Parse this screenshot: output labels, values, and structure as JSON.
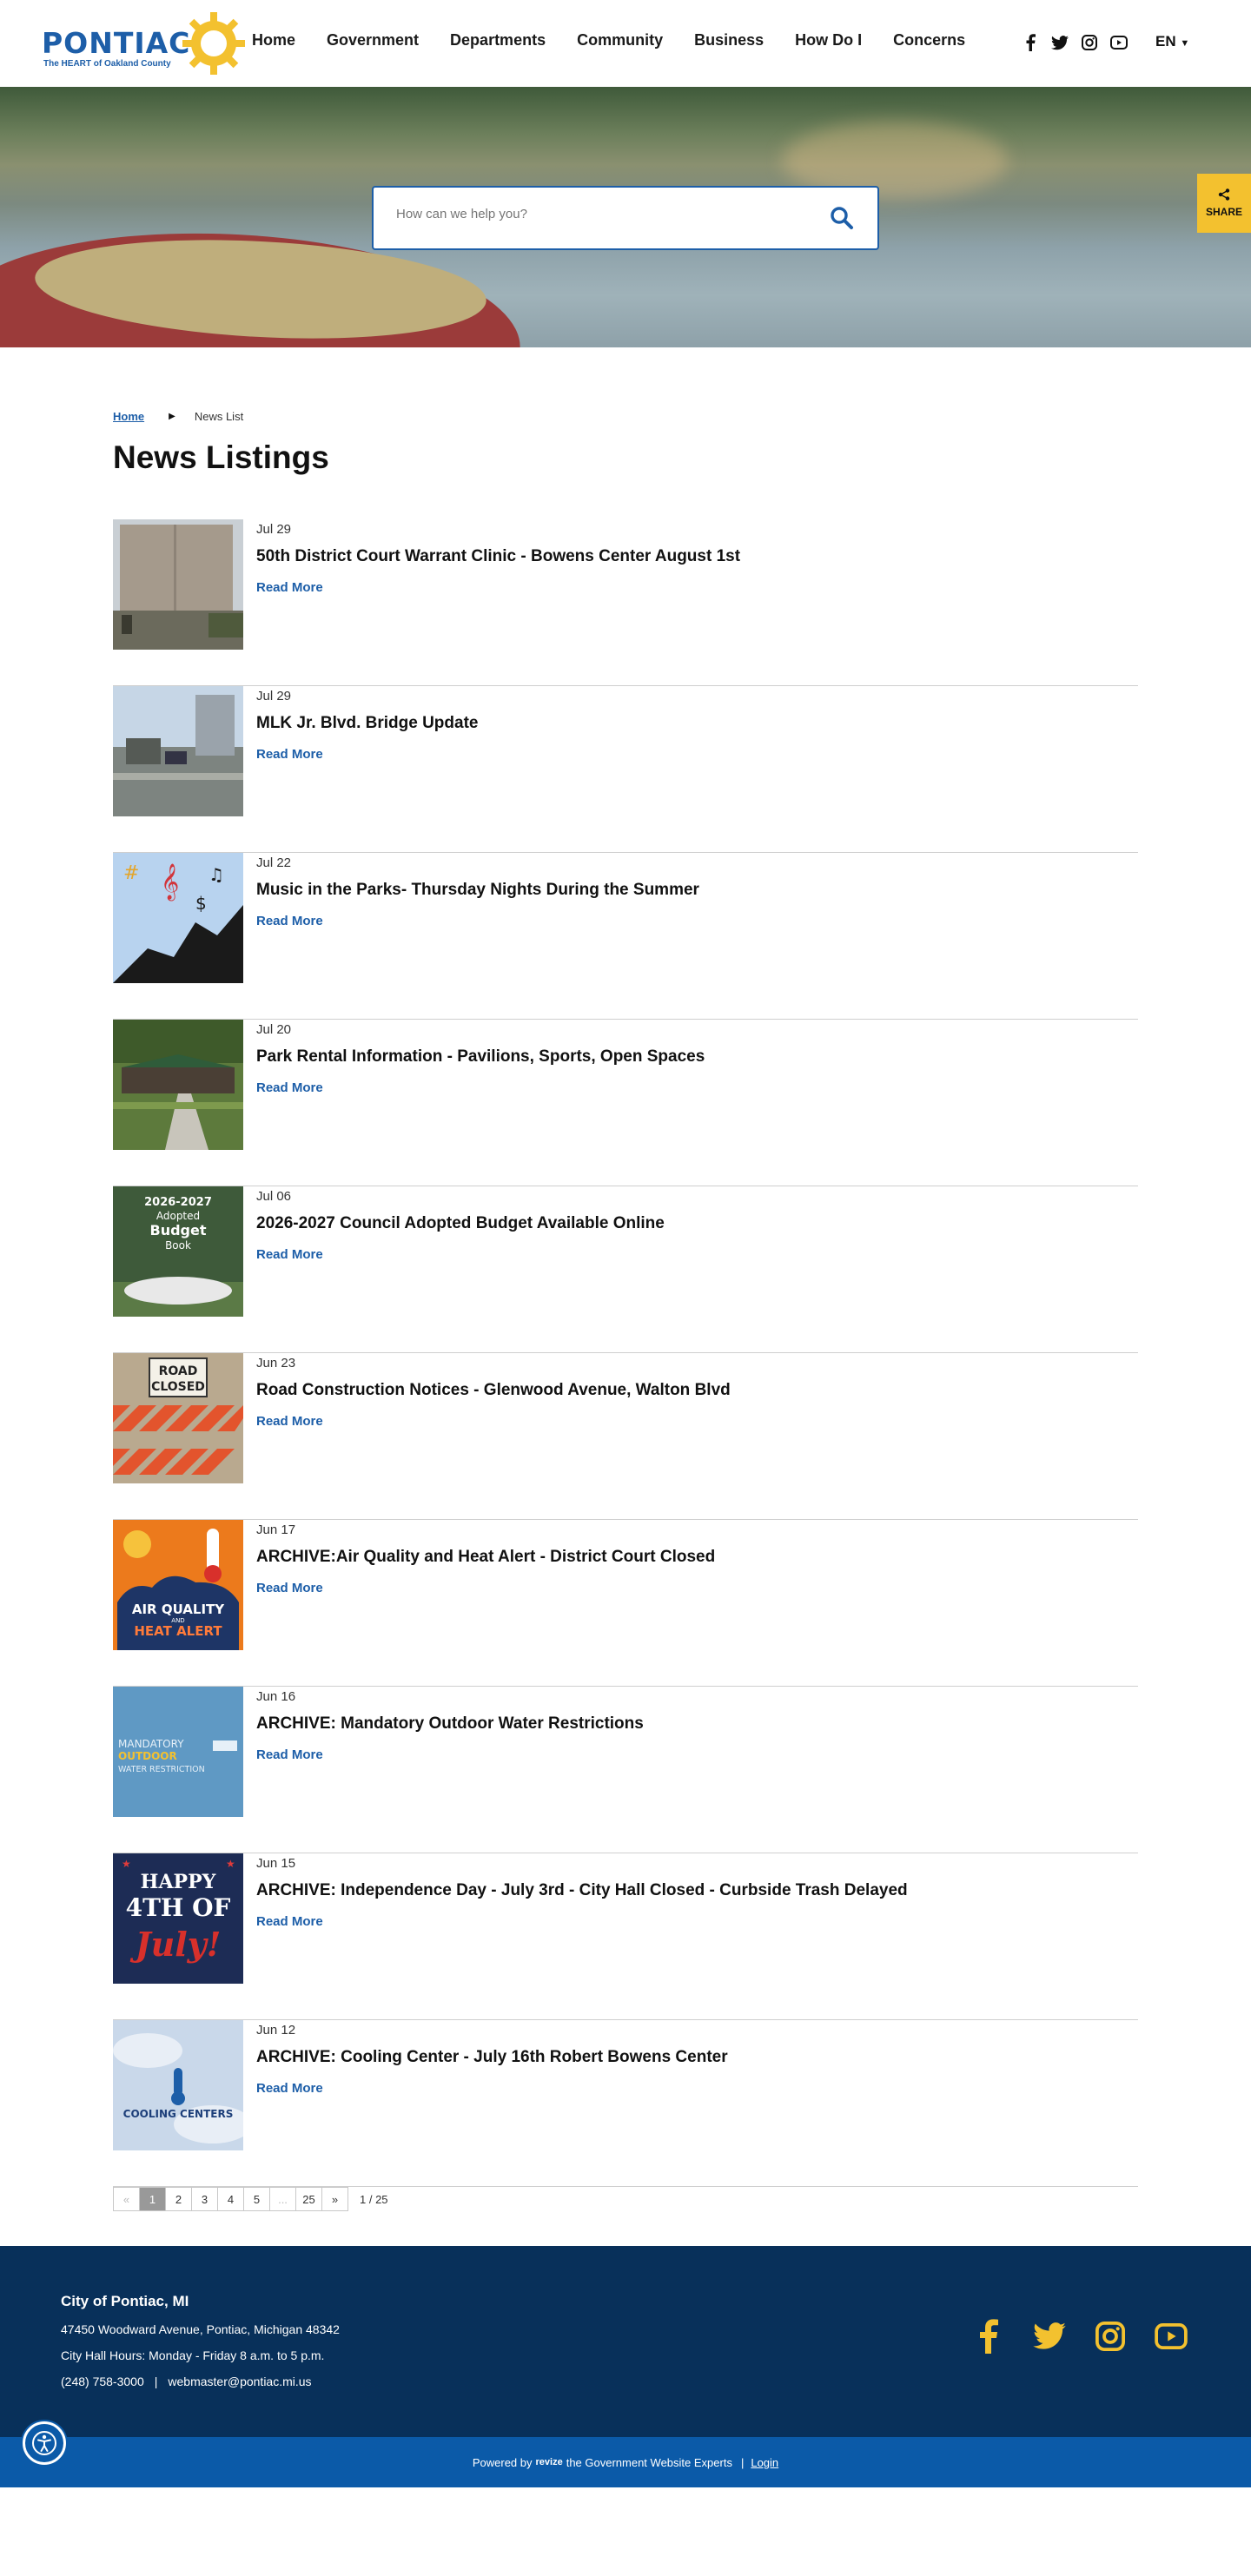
{
  "brand": {
    "logo_word": "PONTIAC",
    "logo_tagline": "The HEART of Oakland County",
    "primary_color": "#1d5ea8",
    "accent_color": "#f3c12f",
    "footer_color": "#08305a"
  },
  "nav": {
    "items": [
      "Home",
      "Government",
      "Departments",
      "Community",
      "Business",
      "How Do I",
      "Concerns"
    ]
  },
  "header_social": [
    "facebook-icon",
    "twitter-icon",
    "instagram-icon",
    "youtube-icon"
  ],
  "language": {
    "label": "EN"
  },
  "search": {
    "placeholder": "How can we help you?"
  },
  "share": {
    "label": "SHARE"
  },
  "breadcrumb": {
    "home": "Home",
    "current": "News List"
  },
  "page_title": "News Listings",
  "news": [
    {
      "date": "Jul 29",
      "title": "50th District Court Warrant Clinic - Bowens Center August 1st",
      "link": "Read More",
      "thumb": "building"
    },
    {
      "date": "Jul 29",
      "title": "MLK Jr. Blvd. Bridge Update",
      "link": "Read More",
      "thumb": "bridge"
    },
    {
      "date": "Jul 22",
      "title": "Music in the Parks- Thursday Nights During the Summer",
      "link": "Read More",
      "thumb": "music"
    },
    {
      "date": "Jul 20",
      "title": "Park Rental Information - Pavilions, Sports, Open Spaces",
      "link": "Read More",
      "thumb": "park"
    },
    {
      "date": "Jul 06",
      "title": "2026-2027 Council Adopted Budget Available Online",
      "link": "Read More",
      "thumb": "budget",
      "thumb_text": [
        "2026-2027",
        "Adopted",
        "Budget",
        "Book"
      ]
    },
    {
      "date": "Jun 23",
      "title": "Road Construction Notices - Glenwood Avenue, Walton Blvd",
      "link": "Read More",
      "thumb": "road",
      "thumb_text": [
        "ROAD",
        "CLOSED"
      ]
    },
    {
      "date": "Jun 17",
      "title": "ARCHIVE:Air Quality and Heat Alert - District Court Closed",
      "link": "Read More",
      "thumb": "heat",
      "thumb_text": [
        "AIR QUALITY",
        "AND",
        "HEAT ALERT"
      ]
    },
    {
      "date": "Jun 16",
      "title": "ARCHIVE: Mandatory Outdoor Water Restrictions",
      "link": "Read More",
      "thumb": "water",
      "thumb_text": [
        "MANDATORY",
        "OUTDOOR",
        "WATER RESTRICTION"
      ]
    },
    {
      "date": "Jun 15",
      "title": "ARCHIVE: Independence Day - July 3rd - City Hall Closed - Curbside Trash Delayed",
      "link": "Read More",
      "thumb": "july",
      "thumb_text": [
        "HAPPY",
        "4TH OF",
        "July!"
      ]
    },
    {
      "date": "Jun 12",
      "title": "ARCHIVE: Cooling Center - July  16th Robert Bowens Center",
      "link": "Read More",
      "thumb": "cooling",
      "thumb_text": [
        "COOLING CENTERS"
      ]
    }
  ],
  "pagination": {
    "prev": "«",
    "pages": [
      "1",
      "2",
      "3",
      "4",
      "5",
      "...",
      "25"
    ],
    "next": "»",
    "current": 1,
    "count_text": "1 / 25"
  },
  "footer": {
    "name": "City of Pontiac, MI",
    "address": "47450 Woodward Avenue, Pontiac, Michigan 48342",
    "hours": "City Hall Hours: Monday - Friday 8 a.m. to 5 p.m.",
    "phone": "(248) 758-3000",
    "separator": "|",
    "email": "webmaster@pontiac.mi.us",
    "social": [
      "facebook-icon",
      "twitter-icon",
      "instagram-icon",
      "youtube-icon"
    ]
  },
  "powered": {
    "prefix": "Powered by",
    "brand": "revize",
    "suffix": "the Government Website Experts",
    "separator": "|",
    "login": "Login"
  }
}
